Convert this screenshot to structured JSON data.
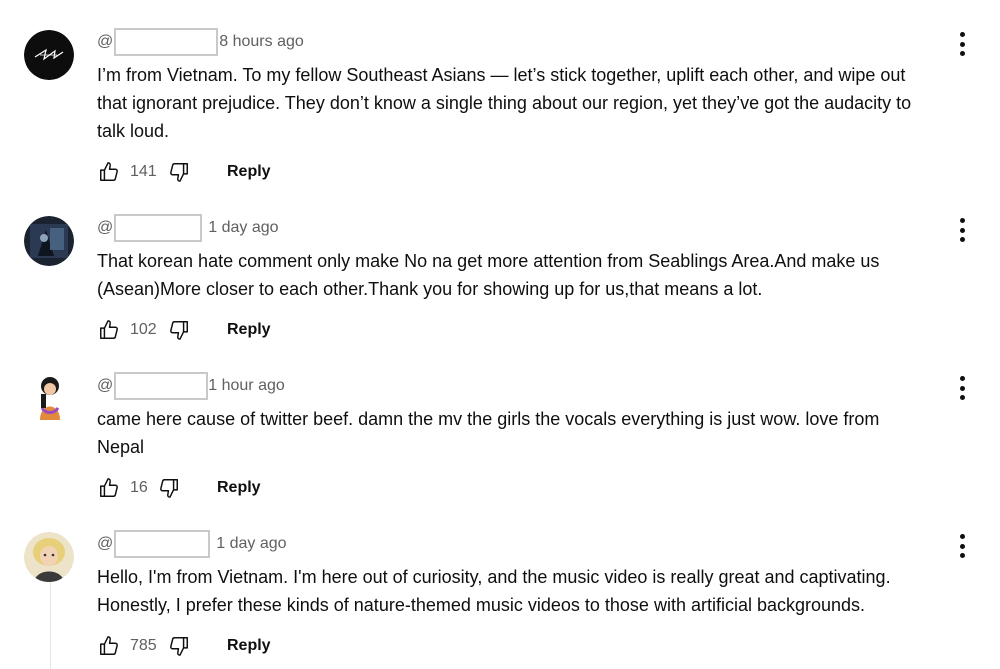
{
  "comments": [
    {
      "at": "@",
      "time": "8 hours ago",
      "text": "I’m from Vietnam. To my fellow Southeast Asians — let’s stick together, uplift each other, and wipe out\nthat ignorant prejudice. They don’t know a single thing about our region, yet they’ve got the audacity to\ntalk loud.",
      "likes": "141",
      "reply_label": "Reply"
    },
    {
      "at": "@",
      "time": "1 day ago",
      "text": "That korean hate comment only make No na get more attention from Seablings Area.And make us\n(Asean)More closer to each other.Thank you for showing up for us,that means a lot.",
      "likes": "102",
      "reply_label": "Reply"
    },
    {
      "at": "@",
      "time": "1 hour ago",
      "text": "came here cause of twitter beef. damn the mv the girls the vocals everything is just wow. love from\nNepal",
      "likes": "16",
      "reply_label": "Reply"
    },
    {
      "at": "@",
      "time": "1 day ago",
      "text": "Hello, I'm from Vietnam. I'm here out of curiosity, and the music video is really great and captivating.\nHonestly, I prefer these kinds of nature-themed music videos to those with artificial backgrounds.",
      "likes": "785",
      "reply_label": "Reply"
    }
  ],
  "icons": {
    "like": "thumbs-up-outline-icon",
    "dislike": "thumbs-down-outline-icon",
    "more": "vertical-ellipsis-icon"
  },
  "colors": {
    "text_primary": "#0f0f0f",
    "text_secondary": "#606060",
    "redaction_border": "#c9c9c9"
  }
}
